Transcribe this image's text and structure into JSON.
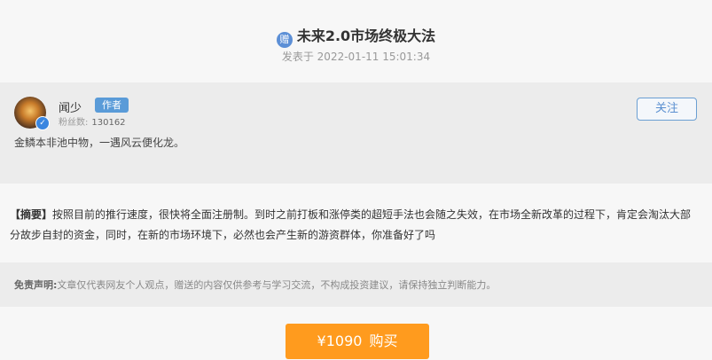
{
  "article": {
    "icon": "gift-icon",
    "icon_glyph": "赠",
    "title": "未来2.0市场终极大法",
    "date": "发表于 2022-01-11 15:01:34"
  },
  "author": {
    "name": "闻少",
    "tag": "作者",
    "fans_label": "粉丝数:",
    "fans_count": "130162",
    "bio": "金鳞本非池中物，一遇风云便化龙。",
    "follow_label": "关注",
    "badge": "✓"
  },
  "summary": {
    "tag": "【摘要】",
    "text": "按照目前的推行速度，很快将全面注册制。到时之前打板和涨停类的超短手法也会随之失效，在市场全新改革的过程下，肯定会淘汰大部分故步自封的资金，同时，在新的市场环境下，必然也会产生新的游资群体，你准备好了吗"
  },
  "disclaimer": {
    "label": "免责声明:",
    "text": "文章仅代表网友个人观点，赠送的内容仅供参考与学习交流，不构成投资建议，请保持独立判断能力。"
  },
  "purchase": {
    "price": "¥1090",
    "label": "购买",
    "color": "#ff9b1e"
  }
}
